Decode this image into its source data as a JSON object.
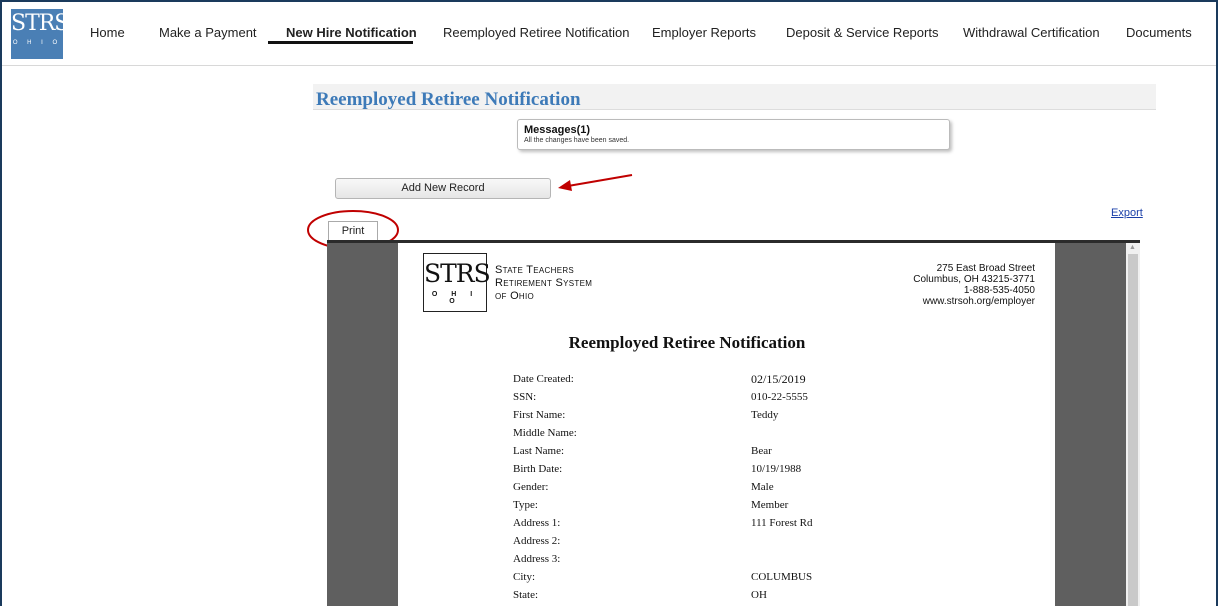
{
  "nav": {
    "logo": {
      "text": "STRS",
      "subtext": "O H I O"
    },
    "items": [
      {
        "label": "Home"
      },
      {
        "label": "Make a Payment"
      },
      {
        "label": "New Hire Notification",
        "active": true
      },
      {
        "label": "Reemployed Retiree Notification"
      },
      {
        "label": "Employer Reports"
      },
      {
        "label": "Deposit & Service Reports"
      },
      {
        "label": "Withdrawal Certification"
      },
      {
        "label": "Documents"
      }
    ]
  },
  "page": {
    "title": "Reemployed Retiree Notification",
    "messages": {
      "title": "Messages(1)",
      "text": "All the changes have been saved."
    },
    "add_button": "Add New Record",
    "export_link": "Export",
    "print_tab": "Print"
  },
  "annotations": {
    "color": "#c00000",
    "arrow": "arrow pointing to Add New Record",
    "circle": "circle around Print"
  },
  "document": {
    "logo": {
      "text": "STRS",
      "subtext": "O H I O"
    },
    "org_lines": [
      "State Teachers",
      "Retirement System",
      "of Ohio"
    ],
    "address_lines": [
      "275 East Broad Street",
      "Columbus, OH 43215-3771",
      "1-888-535-4050",
      "www.strsoh.org/employer"
    ],
    "title": "Reemployed Retiree Notification",
    "fields": [
      {
        "label": "Date Created:",
        "value": "02/15/2019"
      },
      {
        "label": "SSN:",
        "value": "010-22-5555"
      },
      {
        "label": "First Name:",
        "value": "Teddy"
      },
      {
        "label": "Middle Name:",
        "value": ""
      },
      {
        "label": "Last Name:",
        "value": "Bear"
      },
      {
        "label": "Birth Date:",
        "value": "10/19/1988"
      },
      {
        "label": "Gender:",
        "value": "Male"
      },
      {
        "label": "Type:",
        "value": "Member"
      },
      {
        "label": "Address 1:",
        "value": "111  Forest Rd"
      },
      {
        "label": "Address 2:",
        "value": ""
      },
      {
        "label": "Address 3:",
        "value": ""
      },
      {
        "label": "City:",
        "value": "COLUMBUS"
      },
      {
        "label": "State:",
        "value": "OH"
      }
    ]
  }
}
